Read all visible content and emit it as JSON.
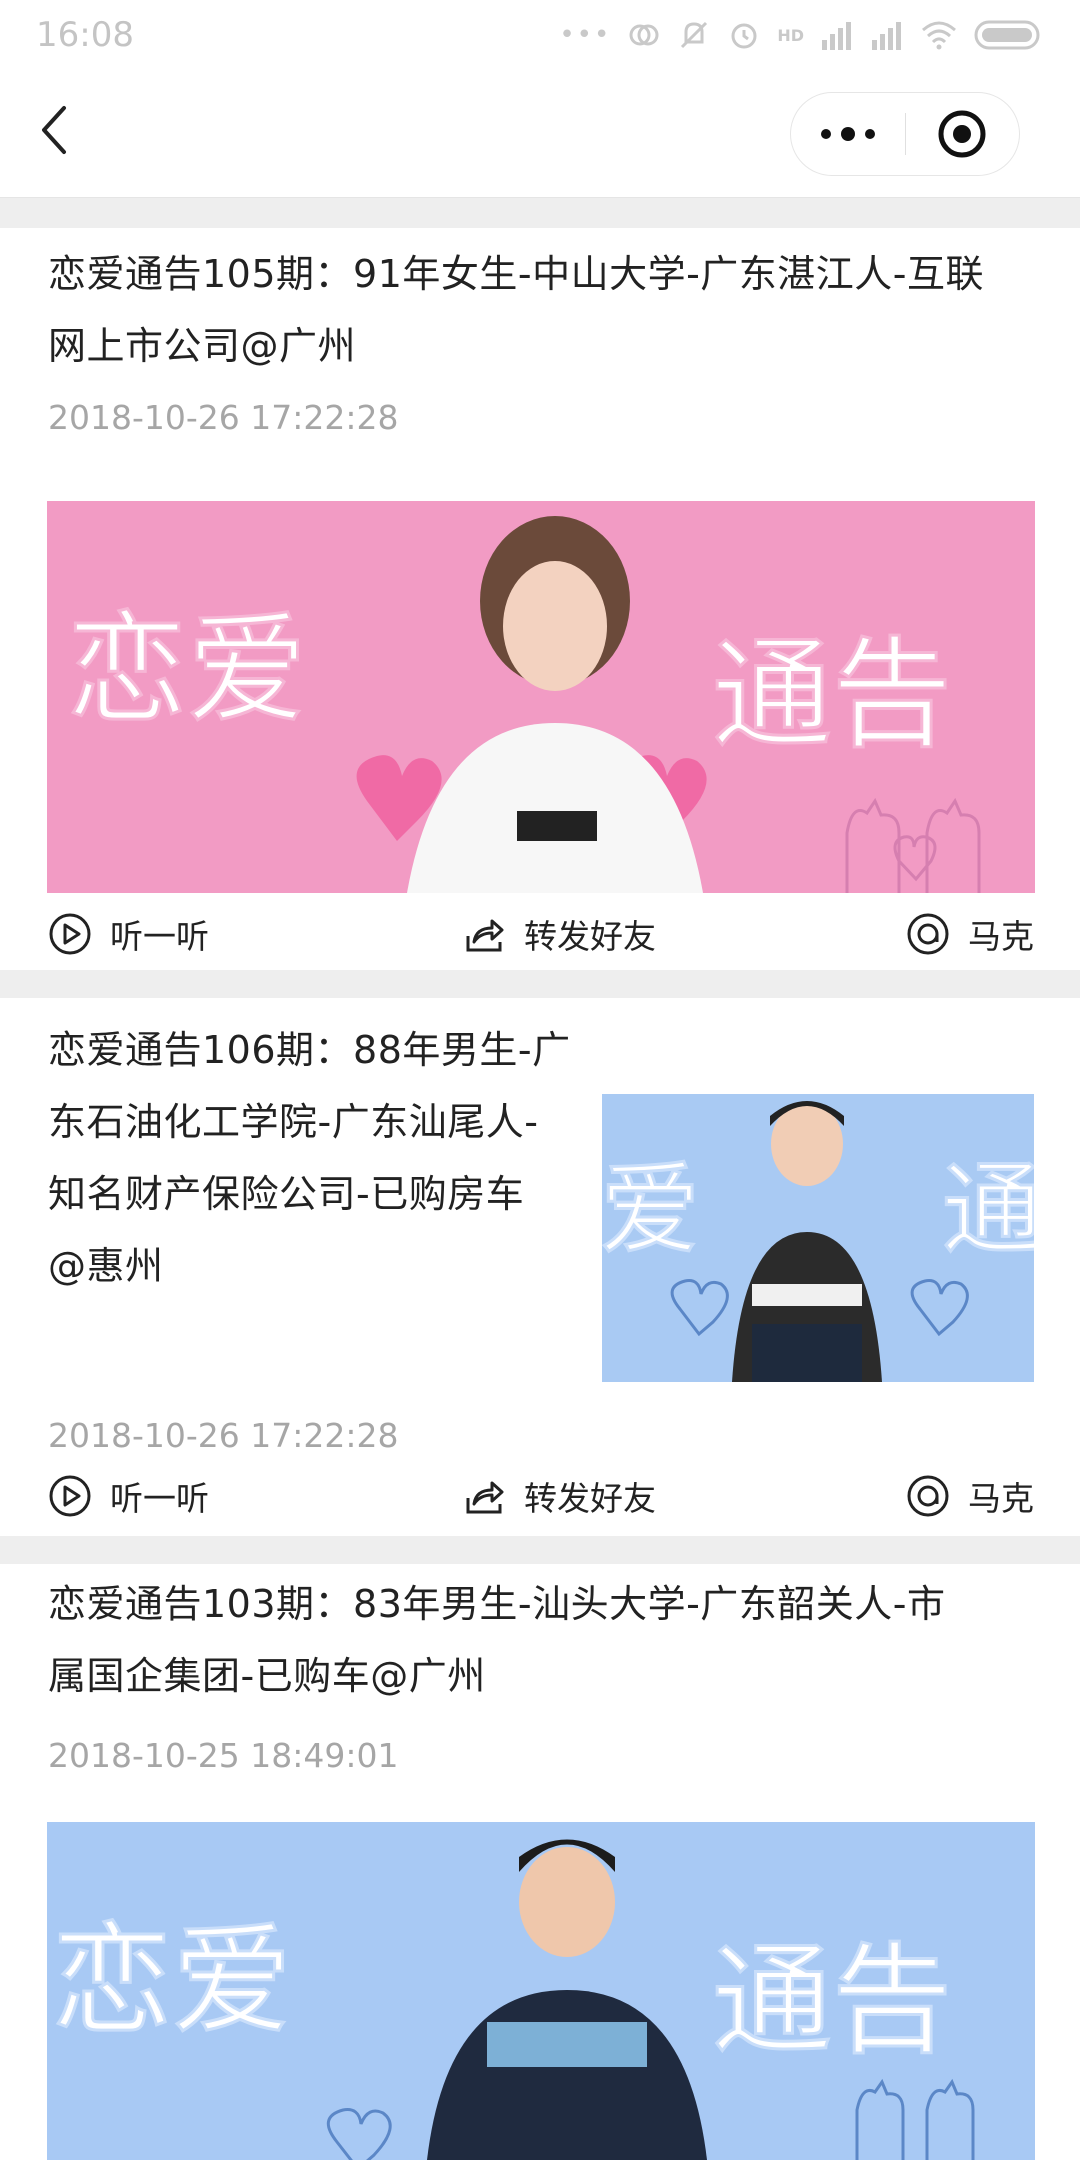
{
  "status_bar": {
    "time": "16:08",
    "hd_label": "HD",
    "dots": "•••"
  },
  "nav": {
    "back_icon": "chevron-left-icon",
    "more_icon": "more-dots-icon",
    "close_icon": "record-circle-icon"
  },
  "actions_labels": {
    "listen": "听一听",
    "share": "转发好友"
  },
  "posts": [
    {
      "title_line1": "恋爱通告105期：91年女生-中山大学-广东湛江人-互联",
      "title_line2": "网上市公司@广州",
      "date": "2018-10-26 17:22:28",
      "banner_text_left": "恋爱",
      "banner_text_right": "通告",
      "banner_color": "#f29bc4",
      "author": "马克"
    },
    {
      "title_lines": [
        "恋爱通告106期：88年男生-广",
        "东石油化工学院-广东汕尾人-",
        "知名财产保险公司-已购房车",
        "@惠州"
      ],
      "date": "2018-10-26 17:22:28",
      "thumb_text_left": "爱",
      "thumb_text_right": "通",
      "thumb_color": "#a9caf3",
      "author": "马克"
    },
    {
      "title_line1": "恋爱通告103期：83年男生-汕头大学-广东韶关人-市",
      "title_line2": "属国企集团-已购车@广州",
      "date": "2018-10-25 18:49:01",
      "banner_text_left": "恋爱",
      "banner_text_right": "通告",
      "banner_color": "#a8c9f4"
    }
  ]
}
